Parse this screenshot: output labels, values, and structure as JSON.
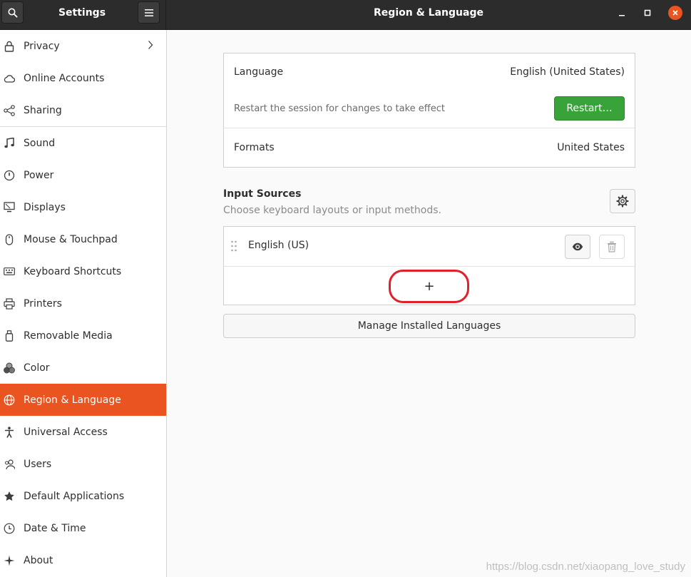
{
  "header": {
    "sidebar_title": "Settings",
    "window_title": "Region & Language"
  },
  "sidebar": {
    "items": [
      {
        "label": "Privacy",
        "icon": "lock-icon"
      },
      {
        "label": "Online Accounts",
        "icon": "cloud-icon"
      },
      {
        "label": "Sharing",
        "icon": "share-icon"
      },
      {
        "label": "Sound",
        "icon": "music-note-icon"
      },
      {
        "label": "Power",
        "icon": "power-icon"
      },
      {
        "label": "Displays",
        "icon": "display-icon"
      },
      {
        "label": "Mouse & Touchpad",
        "icon": "mouse-icon"
      },
      {
        "label": "Keyboard Shortcuts",
        "icon": "keyboard-icon"
      },
      {
        "label": "Printers",
        "icon": "printer-icon"
      },
      {
        "label": "Removable Media",
        "icon": "usb-drive-icon"
      },
      {
        "label": "Color",
        "icon": "color-circles-icon"
      },
      {
        "label": "Region & Language",
        "icon": "globe-icon",
        "active": true
      },
      {
        "label": "Universal Access",
        "icon": "accessibility-icon"
      },
      {
        "label": "Users",
        "icon": "users-icon"
      },
      {
        "label": "Default Applications",
        "icon": "star-icon"
      },
      {
        "label": "Date & Time",
        "icon": "clock-icon"
      },
      {
        "label": "About",
        "icon": "about-icon"
      }
    ]
  },
  "language_card": {
    "language_label": "Language",
    "language_value": "English (United States)",
    "restart_note": "Restart the session for changes to take effect",
    "restart_button": "Restart…",
    "formats_label": "Formats",
    "formats_value": "United States"
  },
  "input_sources": {
    "title": "Input Sources",
    "subtitle": "Choose keyboard layouts or input methods.",
    "sources": [
      {
        "name": "English (US)"
      }
    ],
    "add_button": "+"
  },
  "manage_button": "Manage Installed Languages",
  "watermark": "https://blog.csdn.net/xiaopang_love_study",
  "colors": {
    "accent": "#e95420",
    "restart_green": "#38a338",
    "highlight_red": "#e0202a",
    "headerbar": "#2c2c2c"
  }
}
